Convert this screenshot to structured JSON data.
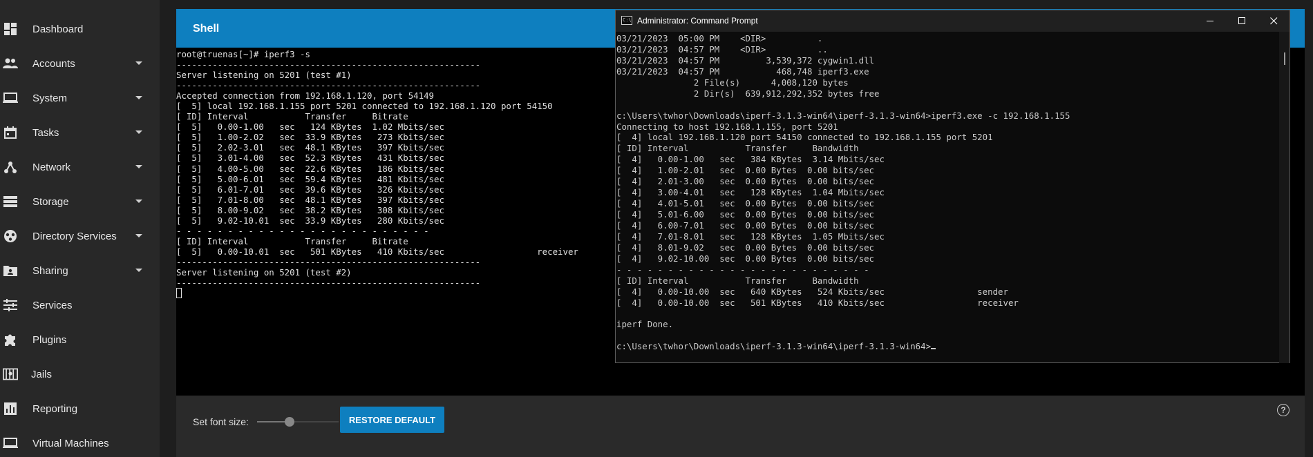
{
  "sidebar": {
    "items": [
      {
        "label": "Dashboard",
        "icon": "dashboard-icon",
        "has_submenu": false
      },
      {
        "label": "Accounts",
        "icon": "accounts-icon",
        "has_submenu": true
      },
      {
        "label": "System",
        "icon": "system-icon",
        "has_submenu": true
      },
      {
        "label": "Tasks",
        "icon": "tasks-icon",
        "has_submenu": true
      },
      {
        "label": "Network",
        "icon": "network-icon",
        "has_submenu": true
      },
      {
        "label": "Storage",
        "icon": "storage-icon",
        "has_submenu": true
      },
      {
        "label": "Directory Services",
        "icon": "directory-services-icon",
        "has_submenu": true
      },
      {
        "label": "Sharing",
        "icon": "sharing-icon",
        "has_submenu": true
      },
      {
        "label": "Services",
        "icon": "services-icon",
        "has_submenu": false
      },
      {
        "label": "Plugins",
        "icon": "plugins-icon",
        "has_submenu": false
      },
      {
        "label": "Jails",
        "icon": "jails-icon",
        "has_submenu": false
      },
      {
        "label": "Reporting",
        "icon": "reporting-icon",
        "has_submenu": false
      },
      {
        "label": "Virtual Machines",
        "icon": "virtual-machines-icon",
        "has_submenu": false
      }
    ]
  },
  "shell": {
    "title": "Shell",
    "lines": [
      "root@truenas[~]# iperf3 -s",
      "-----------------------------------------------------------",
      "Server listening on 5201 (test #1)",
      "-----------------------------------------------------------",
      "Accepted connection from 192.168.1.120, port 54149",
      "[  5] local 192.168.1.155 port 5201 connected to 192.168.1.120 port 54150",
      "[ ID] Interval           Transfer     Bitrate",
      "[  5]   0.00-1.00   sec   124 KBytes  1.02 Mbits/sec",
      "[  5]   1.00-2.02   sec  33.9 KBytes   273 Kbits/sec",
      "[  5]   2.02-3.01   sec  48.1 KBytes   397 Kbits/sec",
      "[  5]   3.01-4.00   sec  52.3 KBytes   431 Kbits/sec",
      "[  5]   4.00-5.00   sec  22.6 KBytes   186 Kbits/sec",
      "[  5]   5.00-6.01   sec  59.4 KBytes   481 Kbits/sec",
      "[  5]   6.01-7.01   sec  39.6 KBytes   326 Kbits/sec",
      "[  5]   7.01-8.00   sec  48.1 KBytes   397 Kbits/sec",
      "[  5]   8.00-9.02   sec  38.2 KBytes   308 Kbits/sec",
      "[  5]   9.02-10.01  sec  33.9 KBytes   280 Kbits/sec",
      "- - - - - - - - - - - - - - - - - - - - - - - - -",
      "[ ID] Interval           Transfer     Bitrate",
      "[  5]   0.00-10.01  sec   501 KBytes   410 Kbits/sec                  receiver",
      "-----------------------------------------------------------",
      "Server listening on 5201 (test #2)",
      "-----------------------------------------------------------"
    ]
  },
  "cmd": {
    "title": "Administrator: Command Prompt",
    "window_buttons": {
      "minimize": "—",
      "maximize": "☐",
      "close": "✕"
    },
    "lines": [
      "03/21/2023  05:00 PM    <DIR>          .",
      "03/21/2023  04:57 PM    <DIR>          ..",
      "03/21/2023  04:57 PM         3,539,372 cygwin1.dll",
      "03/21/2023  04:57 PM           468,748 iperf3.exe",
      "               2 File(s)      4,008,120 bytes",
      "               2 Dir(s)  639,912,292,352 bytes free",
      "",
      "c:\\Users\\twhor\\Downloads\\iperf-3.1.3-win64\\iperf-3.1.3-win64>iperf3.exe -c 192.168.1.155",
      "Connecting to host 192.168.1.155, port 5201",
      "[  4] local 192.168.1.120 port 54150 connected to 192.168.1.155 port 5201",
      "[ ID] Interval           Transfer     Bandwidth",
      "[  4]   0.00-1.00   sec   384 KBytes  3.14 Mbits/sec",
      "[  4]   1.00-2.01   sec  0.00 Bytes  0.00 bits/sec",
      "[  4]   2.01-3.00   sec  0.00 Bytes  0.00 bits/sec",
      "[  4]   3.00-4.01   sec   128 KBytes  1.04 Mbits/sec",
      "[  4]   4.01-5.01   sec  0.00 Bytes  0.00 bits/sec",
      "[  4]   5.01-6.00   sec  0.00 Bytes  0.00 bits/sec",
      "[  4]   6.00-7.01   sec  0.00 Bytes  0.00 bits/sec",
      "[  4]   7.01-8.01   sec   128 KBytes  1.05 Mbits/sec",
      "[  4]   8.01-9.02   sec  0.00 Bytes  0.00 bits/sec",
      "[  4]   9.02-10.00  sec  0.00 Bytes  0.00 bits/sec",
      "- - - - - - - - - - - - - - - - - - - - - - - - -",
      "[ ID] Interval           Transfer     Bandwidth",
      "[  4]   0.00-10.00  sec   640 KBytes   524 Kbits/sec                  sender",
      "[  4]   0.00-10.00  sec   501 KBytes   410 Kbits/sec                  receiver",
      "",
      "iperf Done.",
      ""
    ],
    "prompt": "c:\\Users\\twhor\\Downloads\\iperf-3.1.3-win64\\iperf-3.1.3-win64>"
  },
  "footer": {
    "font_size_label": "Set font size:",
    "font_size_level": 0.4,
    "restore_label": "RESTORE DEFAULT",
    "help_icon": "help-icon"
  },
  "colors": {
    "accent": "#0e7fbf",
    "sidebar_bg": "#282828",
    "page_bg": "#1e1e1e",
    "terminal_bg": "#000000"
  }
}
